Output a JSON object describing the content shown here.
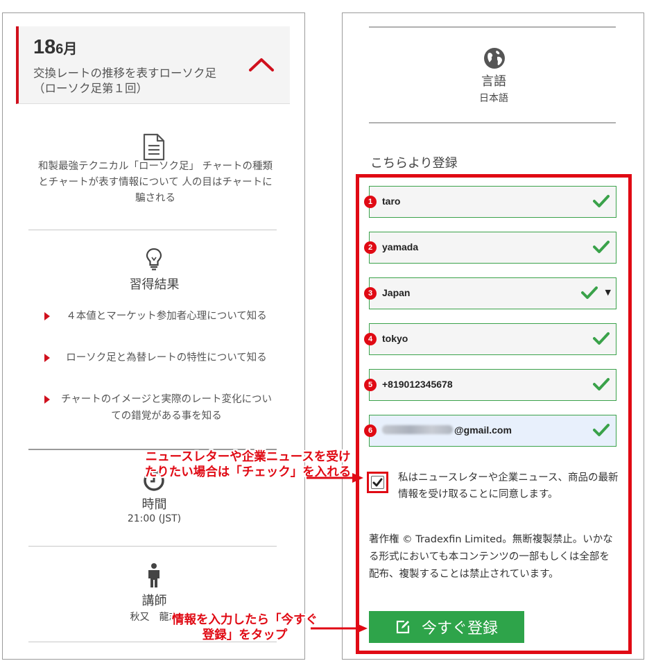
{
  "left_panel": {
    "event": {
      "day": "18",
      "month": "6月",
      "title": "交換レートの推移を表すローソク足（ローソク足第１回）"
    },
    "description": "和製最強テクニカル「ローソク足」 チャートの種類とチャートが表す情報について 人の目はチャートに騙される",
    "results_title": "習得結果",
    "results": [
      "４本値とマーケット参加者心理について知る",
      "ローソク足と為替レートの特性について知る",
      "チャートのイメージと実際のレート変化についての錯覚がある事を知る"
    ],
    "time_title": "時間",
    "time_value": "21:00 (JST)",
    "instructor_title": "講師",
    "instructor_name": "秋又　龍志"
  },
  "right_panel": {
    "language_title": "言語",
    "language_value": "日本語",
    "register_heading": "こちらより登録",
    "fields": [
      {
        "number": "1",
        "value": "taro"
      },
      {
        "number": "2",
        "value": "yamada"
      },
      {
        "number": "3",
        "value": "Japan",
        "caret": "▼"
      },
      {
        "number": "4",
        "value": "tokyo"
      },
      {
        "number": "5",
        "value": "+819012345678"
      },
      {
        "number": "6",
        "value": "@gmail.com"
      }
    ],
    "consent_text": "私はニュースレターや企業ニュース、商品の最新情報を受け取ることに同意します。",
    "copyright": "著作権 © Tradexfin Limited。無断複製禁止。いかなる形式においても本コンテンツの一部もしくは全部を配布、複製することは禁止されています。",
    "register_button": "今すぐ登録"
  },
  "annotations": {
    "newsletter": "ニュースレターや企業ニュースを受けたりたい場合は「チェック」を入れる",
    "register": "情報を入力したら「今すぐ登録」をタップ"
  },
  "colors": {
    "accent_red": "#d0101d",
    "annotation_red": "#e00a14",
    "valid_green": "#3aa24a",
    "button_green": "#2ea44a"
  }
}
